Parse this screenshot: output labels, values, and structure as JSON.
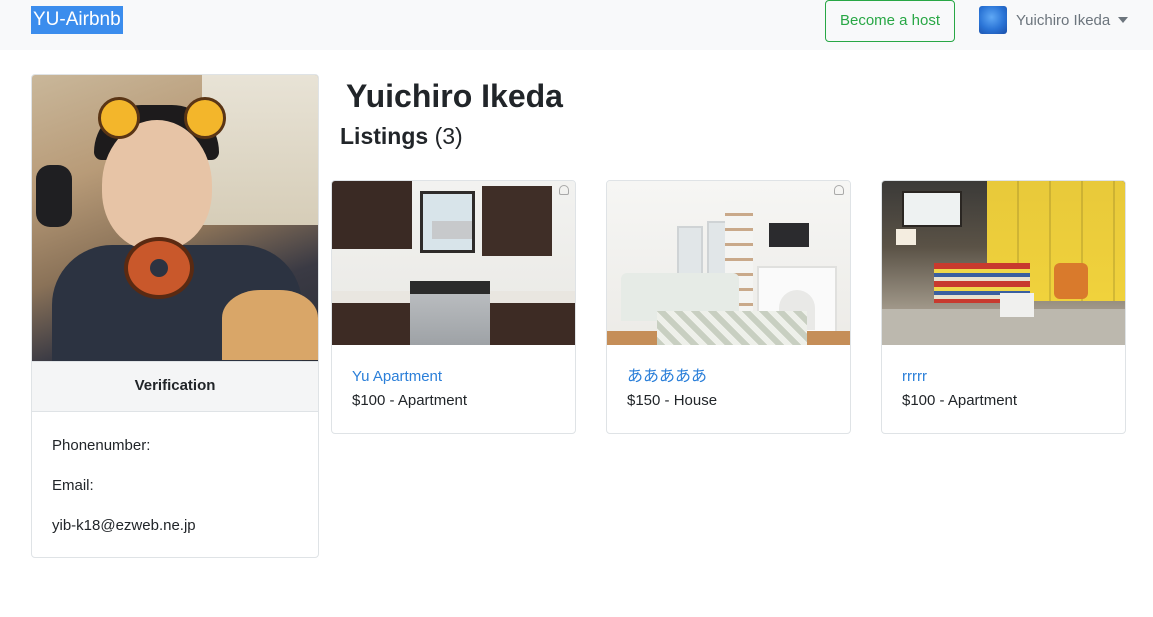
{
  "navbar": {
    "brand": "YU-Airbnb",
    "become_host_label": "Become a host",
    "user_name": "Yuichiro Ikeda"
  },
  "profile": {
    "verification_label": "Verification",
    "phone_label": "Phonenumber:",
    "email_label": "Email:",
    "email_value": "yib-k18@ezweb.ne.jp"
  },
  "main": {
    "user_heading": "Yuichiro Ikeda",
    "listings_label": "Listings",
    "listings_count": "(3)",
    "listings": [
      {
        "title": "Yu Apartment",
        "subtitle": "$100 - Apartment"
      },
      {
        "title": "あああああ",
        "subtitle": "$150 - House"
      },
      {
        "title": "rrrrr",
        "subtitle": "$100 - Apartment"
      }
    ]
  },
  "colors": {
    "brand_highlight": "#3b8ded",
    "host_button": "#28a745",
    "link": "#2b7fd9",
    "navbar_bg": "#f8f9fa"
  }
}
